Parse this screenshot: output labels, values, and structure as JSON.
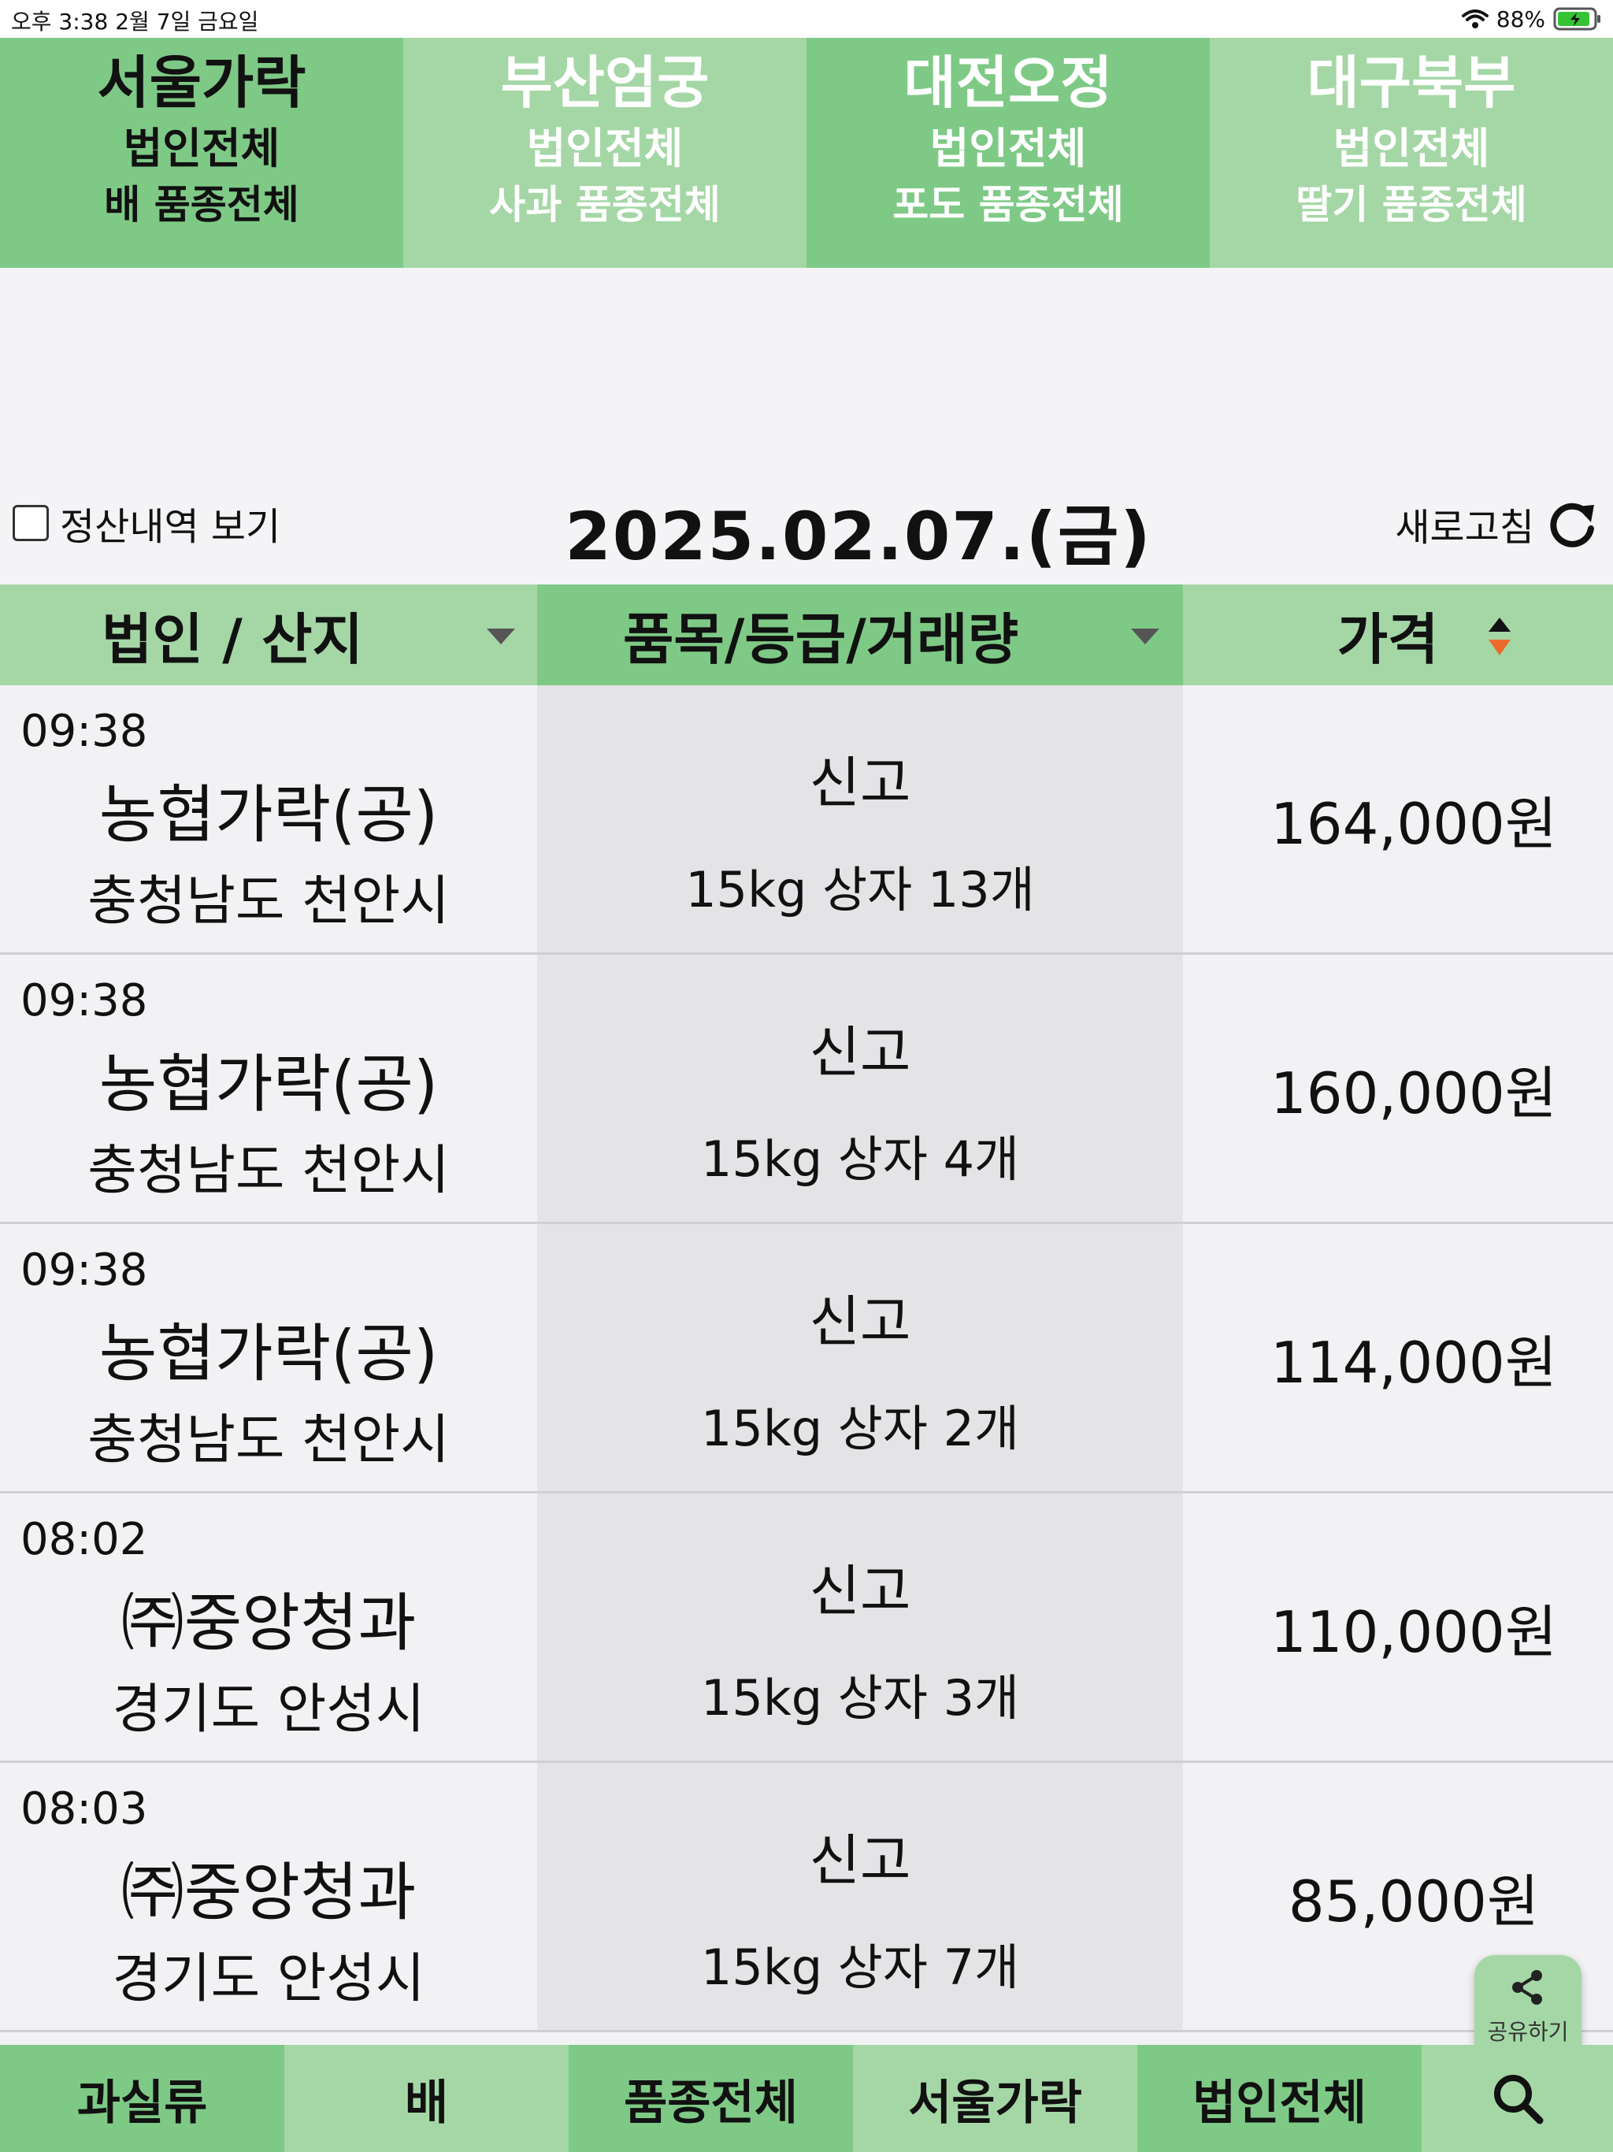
{
  "status_bar": {
    "time": "오후 3:38   2월 7일 금요일",
    "battery": "88%"
  },
  "market_tabs": [
    {
      "market": "서울가락",
      "corp": "법인전체",
      "variety": "배 품종전체"
    },
    {
      "market": "부산엄궁",
      "corp": "법인전체",
      "variety": "사과 품종전체"
    },
    {
      "market": "대전오정",
      "corp": "법인전체",
      "variety": "포도 품종전체"
    },
    {
      "market": "대구북부",
      "corp": "법인전체",
      "variety": "딸기 품종전체"
    }
  ],
  "controls": {
    "settlement_label": "정산내역 보기",
    "date": "2025.02.07.(금)",
    "refresh_label": "새로고침"
  },
  "table": {
    "headers": {
      "corp": "법인 / 산지",
      "item": "품목/등급/거래량",
      "price": "가격"
    },
    "rows": [
      {
        "time": "09:38",
        "corp": "농협가락(공)",
        "origin": "충청남도 천안시",
        "grade": "신고",
        "qty": "15kg 상자 13개",
        "price": "164,000원"
      },
      {
        "time": "09:38",
        "corp": "농협가락(공)",
        "origin": "충청남도 천안시",
        "grade": "신고",
        "qty": "15kg 상자 4개",
        "price": "160,000원"
      },
      {
        "time": "09:38",
        "corp": "농협가락(공)",
        "origin": "충청남도 천안시",
        "grade": "신고",
        "qty": "15kg 상자 2개",
        "price": "114,000원"
      },
      {
        "time": "08:02",
        "corp": "㈜중앙청과",
        "origin": "경기도 안성시",
        "grade": "신고",
        "qty": "15kg 상자 3개",
        "price": "110,000원"
      },
      {
        "time": "08:03",
        "corp": "㈜중앙청과",
        "origin": "경기도 안성시",
        "grade": "신고",
        "qty": "15kg 상자 7개",
        "price": "85,000원"
      }
    ]
  },
  "share": {
    "label": "공유하기"
  },
  "bottom_bar": {
    "category": "과실류",
    "item": "배",
    "variety": "품종전체",
    "market": "서울가락",
    "corp": "법인전체"
  },
  "colors": {
    "green_dark": "#7ec986",
    "green_light": "#a5d7a6",
    "sort_accent": "#ee6a2a"
  }
}
